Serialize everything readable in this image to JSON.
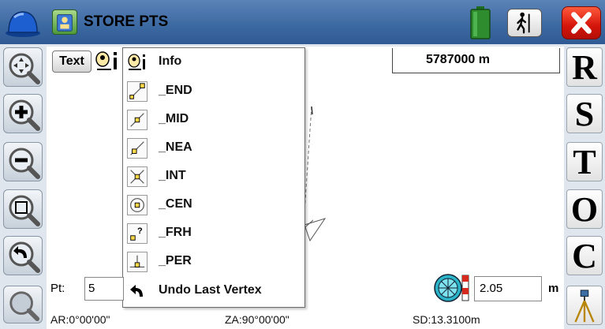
{
  "window": {
    "title": "STORE PTS"
  },
  "toolbar": {
    "text_label": "Text"
  },
  "scale": {
    "value": "5787000 m"
  },
  "snap_menu": {
    "items": [
      {
        "label": "Info",
        "icon": "info-icon"
      },
      {
        "label": "_END",
        "icon": "snap-end-icon"
      },
      {
        "label": "_MID",
        "icon": "snap-mid-icon"
      },
      {
        "label": "_NEA",
        "icon": "snap-nearest-icon"
      },
      {
        "label": "_INT",
        "icon": "snap-intersection-icon"
      },
      {
        "label": "_CEN",
        "icon": "snap-center-icon"
      },
      {
        "label": "_FRH",
        "icon": "snap-from-here-icon"
      },
      {
        "label": "_PER",
        "icon": "snap-perpendicular-icon"
      },
      {
        "label": "Undo Last Vertex",
        "icon": "undo-icon"
      }
    ]
  },
  "right_strip": {
    "r": "R",
    "s": "S",
    "t": "T",
    "o": "O",
    "c": "C"
  },
  "point": {
    "label": "Pt:",
    "value": "5"
  },
  "target_height": {
    "value": "2.05",
    "unit": "m"
  },
  "status": {
    "ar": "AR:0°00'00\"",
    "za": "ZA:90°00'00\"",
    "sd": "SD:13.3100m"
  },
  "colors": {
    "title_bar": "#3e6aa3",
    "close": "#d4150b",
    "battery": "#2e8b2e"
  }
}
